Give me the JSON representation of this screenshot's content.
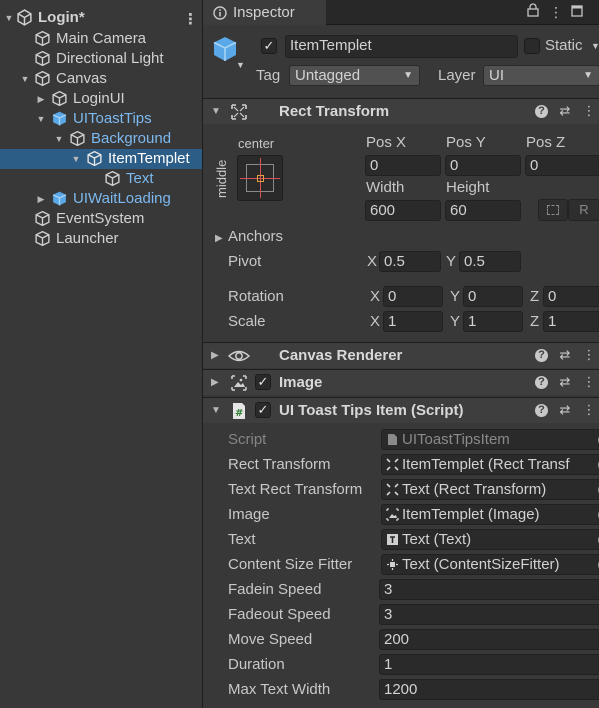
{
  "hierarchy": {
    "scene": "Login*",
    "items": [
      {
        "label": "Main Camera"
      },
      {
        "label": "Directional Light"
      },
      {
        "label": "Canvas"
      },
      {
        "label": "LoginUI"
      },
      {
        "label": "UIToastTips"
      },
      {
        "label": "Background"
      },
      {
        "label": "ItemTemplet"
      },
      {
        "label": "Text"
      },
      {
        "label": "UIWaitLoading"
      },
      {
        "label": "EventSystem"
      },
      {
        "label": "Launcher"
      }
    ]
  },
  "inspector": {
    "tab_label": "Inspector",
    "object": {
      "name": "ItemTemplet",
      "active": true,
      "static_label": "Static",
      "tag_label": "Tag",
      "tag_value": "Untagged",
      "layer_label": "Layer",
      "layer_value": "UI"
    },
    "rect_transform": {
      "title": "Rect Transform",
      "anchor_h": "center",
      "anchor_v": "middle",
      "pos_x_label": "Pos X",
      "pos_x": "0",
      "pos_y_label": "Pos Y",
      "pos_y": "0",
      "pos_z_label": "Pos Z",
      "pos_z": "0",
      "width_label": "Width",
      "width": "600",
      "height_label": "Height",
      "height": "60",
      "raw_button": "R",
      "anchors_label": "Anchors",
      "pivot_label": "Pivot",
      "pivot_x": "0.5",
      "pivot_y": "0.5",
      "rotation_label": "Rotation",
      "rot_x": "0",
      "rot_y": "0",
      "rot_z": "0",
      "scale_label": "Scale",
      "scale_x": "1",
      "scale_y": "1",
      "scale_z": "1",
      "axis_x": "X",
      "axis_y": "Y",
      "axis_z": "Z"
    },
    "canvas_renderer": {
      "title": "Canvas Renderer"
    },
    "image": {
      "title": "Image",
      "enabled": true
    },
    "script_component": {
      "title": "UI Toast Tips Item (Script)",
      "enabled": true,
      "fields": [
        {
          "label": "Script",
          "value": "UIToastTipsItem",
          "icon": "script-file-icon"
        },
        {
          "label": "Rect Transform",
          "value": "ItemTemplet (Rect Transf",
          "icon": "rect-transform-icon"
        },
        {
          "label": "Text Rect Transform",
          "value": "Text (Rect Transform)",
          "icon": "rect-transform-icon"
        },
        {
          "label": "Image",
          "value": "ItemTemplet (Image)",
          "icon": "image-icon"
        },
        {
          "label": "Text",
          "value": "Text (Text)",
          "icon": "text-component-icon"
        },
        {
          "label": "Content Size Fitter",
          "value": "Text (ContentSizeFitter)",
          "icon": "content-size-fitter-icon"
        }
      ],
      "values": [
        {
          "label": "Fadein Speed",
          "value": "3"
        },
        {
          "label": "Fadeout Speed",
          "value": "3"
        },
        {
          "label": "Move Speed",
          "value": "200"
        },
        {
          "label": "Duration",
          "value": "1"
        },
        {
          "label": "Max Text Width",
          "value": "1200"
        }
      ]
    }
  },
  "colors": {
    "selection": "#2c5d87",
    "prefab_blue": "#7cb9f0",
    "panel": "#383838"
  }
}
